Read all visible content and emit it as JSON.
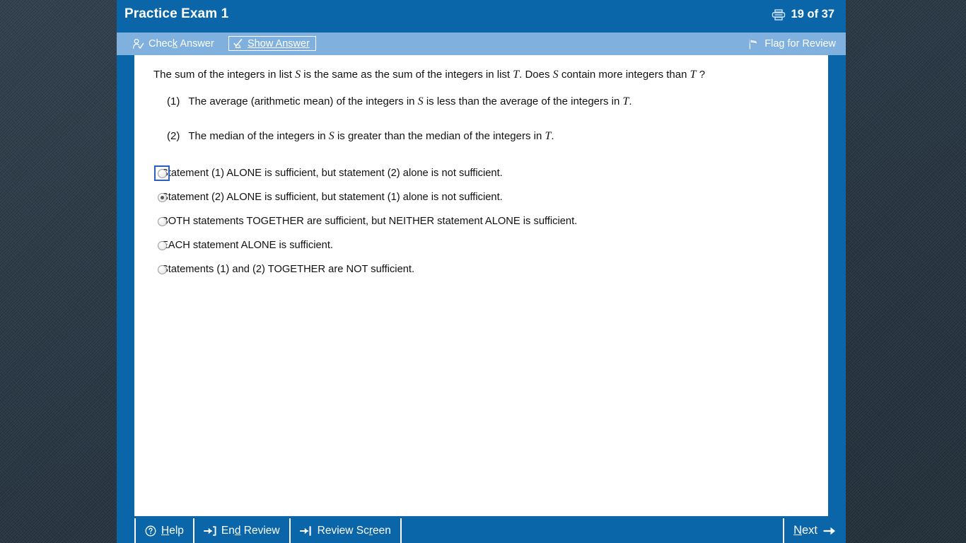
{
  "window": {
    "title": "Practice Exam 1",
    "page_counter": "19 of 37",
    "printer_icon": "printer-icon",
    "accent_color": "#0a66a8",
    "toolbar_color": "#7fb0de",
    "desktop_color": "#2b3b48"
  },
  "action_bar": {
    "check_answer": {
      "label": "Check Answer",
      "icon": "person-check-icon"
    },
    "show_answer": {
      "label": "Show Answer",
      "icon": "check-person-icon"
    },
    "flag_review": {
      "label": "Flag for Review",
      "icon": "flag-icon"
    }
  },
  "question": {
    "stem_part_1": "The sum of the integers in list ",
    "stem_var_1": "S",
    "stem_part_2": " is the same as the sum of the integers in list ",
    "stem_var_2": "T",
    "stem_part_3": ". Does ",
    "stem_var_3": "S",
    "stem_part_4": " contain more integers than ",
    "stem_var_4": "T",
    "stem_part_5": " ?",
    "statements": [
      {
        "number": "(1)",
        "text_part_1": "The average (arithmetic mean) of the integers in ",
        "var_1": "S",
        "text_part_2": " is less than the average of the integers in ",
        "var_2": "T",
        "text_part_3": "."
      },
      {
        "number": "(2)",
        "text_part_1": "The median of the integers in ",
        "var_1": "S",
        "text_part_2": " is greater than the median of the integers in ",
        "var_2": "T",
        "text_part_3": "."
      }
    ]
  },
  "options": [
    {
      "label": "Statement (1) ALONE is sufficient, but statement (2) alone is not sufficient.",
      "selected": false,
      "focused": true
    },
    {
      "label": "Statement (2) ALONE is sufficient, but statement (1) alone is not sufficient.",
      "selected": true,
      "focused": false
    },
    {
      "label": "BOTH statements TOGETHER are sufficient, but NEITHER statement ALONE is sufficient.",
      "selected": false,
      "focused": false
    },
    {
      "label": "EACH statement ALONE is sufficient.",
      "selected": false,
      "focused": false
    },
    {
      "label": "Statements (1) and (2) TOGETHER are NOT sufficient.",
      "selected": false,
      "focused": false
    }
  ],
  "bottom_bar": {
    "help": {
      "label_pre": "",
      "accel": "H",
      "label_post": "elp",
      "icon": "question-circle-icon"
    },
    "end_review": {
      "label_pre": "En",
      "accel": "d",
      "label_post": " Review",
      "icon": "arrow-into-bracket-icon"
    },
    "review_screen": {
      "label_pre": "Review Sc",
      "accel": "r",
      "label_post": "een",
      "icon": "arrow-to-bar-icon"
    },
    "next": {
      "accel": "N",
      "label_post": "ext",
      "icon": "arrow-right-icon"
    }
  }
}
